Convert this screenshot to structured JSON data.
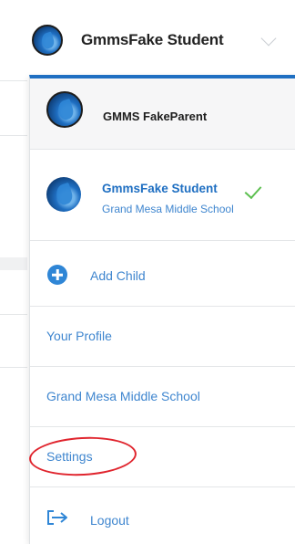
{
  "header": {
    "current_user": "GmmsFake Student",
    "avatar_icon": "user-avatar-icon",
    "chevron_icon": "chevron-down-icon"
  },
  "menu": {
    "accent_color": "#1f6fc2",
    "parent": {
      "name": "GMMS FakeParent"
    },
    "student": {
      "name": "GmmsFake Student",
      "school": "Grand Mesa Middle School",
      "selected": true,
      "check_icon": "checkmark-icon"
    },
    "add_child": {
      "label": "Add Child",
      "icon": "plus-circle-icon"
    },
    "links": {
      "profile": "Your Profile",
      "school": "Grand Mesa Middle School",
      "settings": "Settings"
    },
    "logout": {
      "label": "Logout",
      "icon": "logout-icon"
    },
    "highlight_color": "#e0252e"
  }
}
